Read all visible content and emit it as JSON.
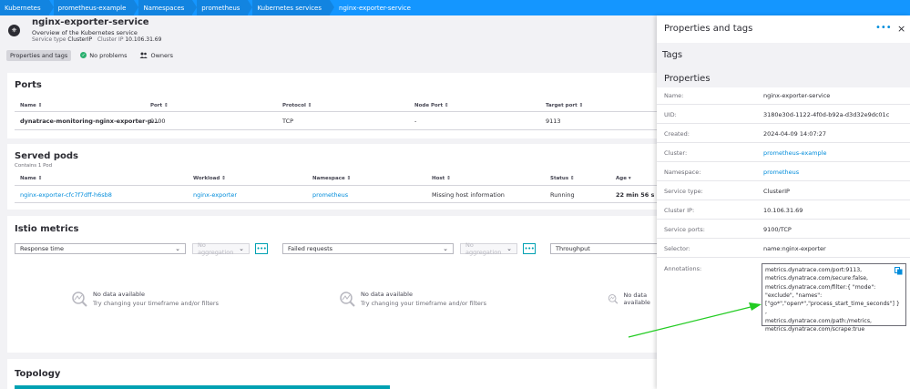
{
  "breadcrumb": [
    "Kubernetes",
    "prometheus-example",
    "Namespaces",
    "prometheus",
    "Kubernetes services",
    "nginx-exporter-service"
  ],
  "header": {
    "title": "nginx-exporter-service",
    "subtitle": "Overview of the Kubernetes service",
    "service_type_label": "Service type",
    "service_type": "ClusterIP",
    "cluster_ip_label": "Cluster IP",
    "cluster_ip": "10.106.31.69"
  },
  "tabs": {
    "properties": "Properties and tags",
    "problems": "No problems",
    "owners": "Owners"
  },
  "ports": {
    "title": "Ports",
    "columns": [
      "Name",
      "Port",
      "Protocol",
      "Node Port",
      "Target port"
    ],
    "row": [
      "dynatrace-monitoring-nginx-exporter-p...",
      "9100",
      "TCP",
      "-",
      "9113"
    ]
  },
  "pods": {
    "title": "Served pods",
    "subtitle": "Contains 1 Pod",
    "columns": [
      "Name",
      "Workload",
      "Namespace",
      "Host",
      "Status",
      "Age"
    ],
    "row": [
      "nginx-exporter-cfc7f7dff-h6sb8",
      "nginx-exporter",
      "prometheus",
      "Missing host information",
      "Running",
      "22 min 56 s"
    ]
  },
  "istio": {
    "title": "Istio metrics",
    "metric1": "Response time",
    "metric2": "Failed requests",
    "metric3": "Throughput",
    "aggregation": "No aggregation",
    "more": "•••",
    "nodata_title": "No data available",
    "nodata_sub": "Try changing your timeframe and/or filters"
  },
  "topology": {
    "title": "Topology"
  },
  "drawer": {
    "title": "Properties and tags",
    "more": "•••",
    "close": "×",
    "tags_title": "Tags",
    "properties_title": "Properties",
    "rows": [
      {
        "label": "Name:",
        "value": "nginx-exporter-service"
      },
      {
        "label": "UID:",
        "value": "3180e30d-1122-4f0d-b92a-d3d32e9dc01c"
      },
      {
        "label": "Created:",
        "value": "2024-04-09 14:07:27"
      },
      {
        "label": "Cluster:",
        "value": "prometheus-example"
      },
      {
        "label": "Namespace:",
        "value": "prometheus"
      },
      {
        "label": "Service type:",
        "value": "ClusterIP"
      },
      {
        "label": "Cluster IP:",
        "value": "10.106.31.69"
      },
      {
        "label": "Service ports:",
        "value": "9100/TCP"
      },
      {
        "label": "Selector:",
        "value": "name:nginx-exporter"
      }
    ],
    "annotations_label": "Annotations:",
    "annotations": [
      "metrics.dynatrace.com/port:9113,",
      "metrics.dynatrace.com/secure:false,",
      "metrics.dynatrace.com/filter:{ \"mode\":",
      "\"exclude\", \"names\":",
      "[\"go*\",\"open*\",\"process_start_time_seconds\"] } ,",
      "metrics.dynatrace.com/path:/metrics,",
      "metrics.dynatrace.com/scrape:true"
    ]
  },
  "colors": {
    "breadcrumb_bg": "#1496ff",
    "link": "#008cdb",
    "ok": "#2ab06f",
    "arrow": "#22cc22"
  },
  "icons": {
    "service": "kubernetes-service-icon",
    "problems": "check-circle-icon",
    "owners": "people-icon",
    "nodata": "chart-magnifier-icon",
    "copy": "copy-icon"
  }
}
